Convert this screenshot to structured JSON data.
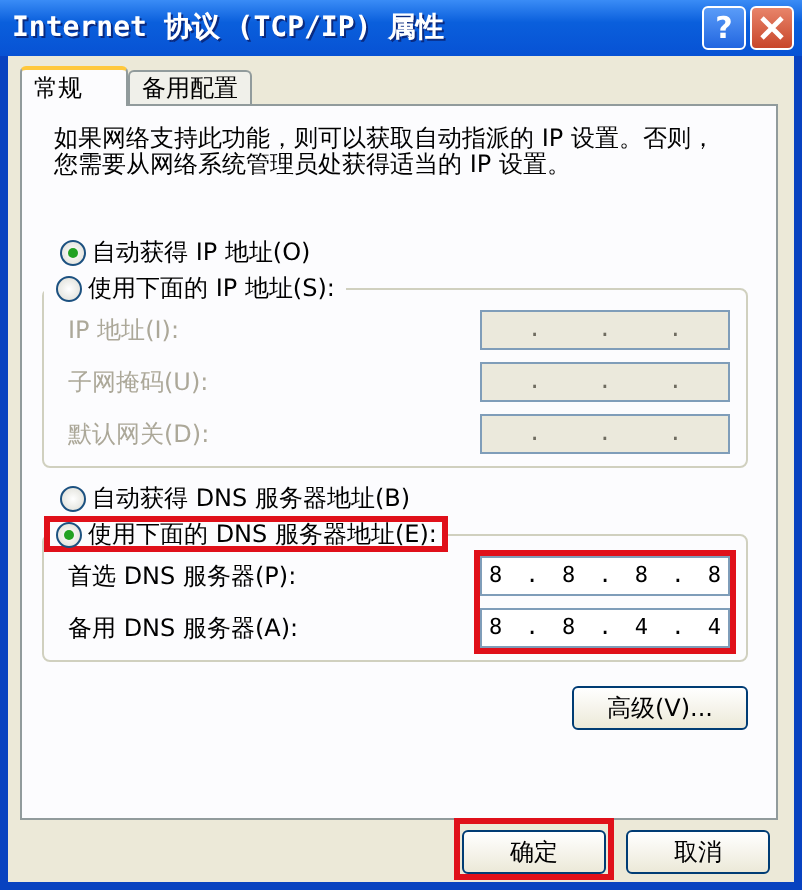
{
  "window": {
    "title": "Internet 协议 (TCP/IP) 属性"
  },
  "title_buttons": [
    {
      "kind": "help",
      "label": "?"
    },
    {
      "kind": "close"
    }
  ],
  "tabs": [
    {
      "label": "常规",
      "selected": true
    },
    {
      "label": "备用配置",
      "selected": false
    }
  ],
  "description_lines": [
    "如果网络支持此功能，则可以获取自动指派的 IP 设置。否则，",
    "您需要从网络系统管理员处获得适当的 IP 设置。"
  ],
  "ip_options": [
    {
      "label": "自动获得 IP 地址(O)",
      "selected": true,
      "highlighted": false
    },
    {
      "label": "使用下面的 IP 地址(S):",
      "selected": false,
      "highlighted": false
    }
  ],
  "ip_fields": {
    "disabled": true,
    "highlighted": false,
    "rows": [
      {
        "label": "IP 地址(I):",
        "value": ". . ."
      },
      {
        "label": "子网掩码(U):",
        "value": ". . ."
      },
      {
        "label": "默认网关(D):",
        "value": ". . ."
      }
    ]
  },
  "dns_options": [
    {
      "label": "自动获得 DNS 服务器地址(B)",
      "selected": false,
      "highlighted": false
    },
    {
      "label": "使用下面的 DNS 服务器地址(E):",
      "selected": true,
      "highlighted": true
    }
  ],
  "dns_fields": {
    "disabled": false,
    "highlighted": true,
    "rows": [
      {
        "label": "首选 DNS 服务器(P):",
        "value": "8 . 8 . 8 . 8"
      },
      {
        "label": "备用 DNS 服务器(A):",
        "value": "8 . 8 . 4 . 4"
      }
    ]
  },
  "advanced_button": "高级(V)...",
  "buttons": [
    {
      "label": "确定",
      "highlighted": true
    },
    {
      "label": "取消",
      "highlighted": false
    }
  ]
}
